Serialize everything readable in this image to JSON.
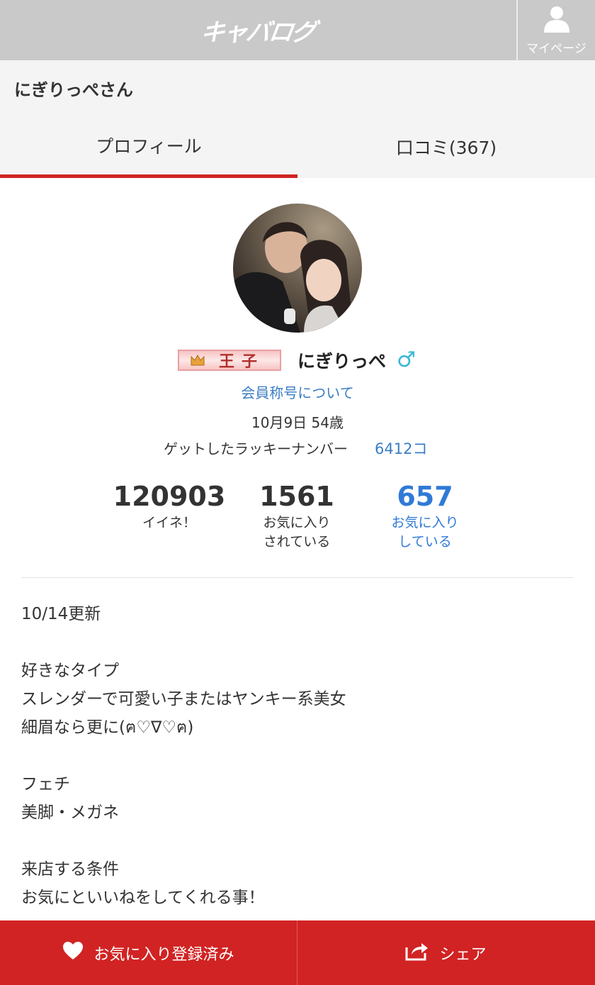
{
  "header": {
    "logo_text": "キャバログ",
    "mypage_label": "マイページ",
    "bg_color": "#c9c9c9"
  },
  "page": {
    "title": "にぎりっぺさん"
  },
  "tabs": [
    {
      "label": "プロフィール",
      "active": true
    },
    {
      "label": "口コミ(367)",
      "active": false
    }
  ],
  "profile": {
    "badge_text": "王子",
    "username": "にぎりっぺ",
    "gender_symbol": "♂",
    "rank_link": "会員称号について",
    "birth_age": "10月9日 54歳",
    "lucky_label": "ゲットしたラッキーナンバー",
    "lucky_value": "6412コ"
  },
  "stats": [
    {
      "value": "120903",
      "label": "イイネ！"
    },
    {
      "value": "1561",
      "label": "お気に入り\nされている"
    },
    {
      "value": "657",
      "label": "お気に入り\nしている"
    }
  ],
  "profile_text": [
    "10/14更新",
    "",
    "好きなタイプ",
    "スレンダーで可愛い子またはヤンキー系美女",
    "細眉なら更に(ฅ♡∇♡ฅ)",
    "",
    "フェチ",
    "美脚・メガネ",
    "",
    "来店する条件",
    "お気にといいねをしてくれる事！"
  ],
  "bottom_bar": {
    "favorite_label": "お気に入り登録済み",
    "share_label": "シェア"
  },
  "colors": {
    "accent_red": "#d12323",
    "link_blue": "#3b7dc4",
    "stat_blue": "#2f7ad6",
    "gender_blue": "#3ab7d6"
  }
}
